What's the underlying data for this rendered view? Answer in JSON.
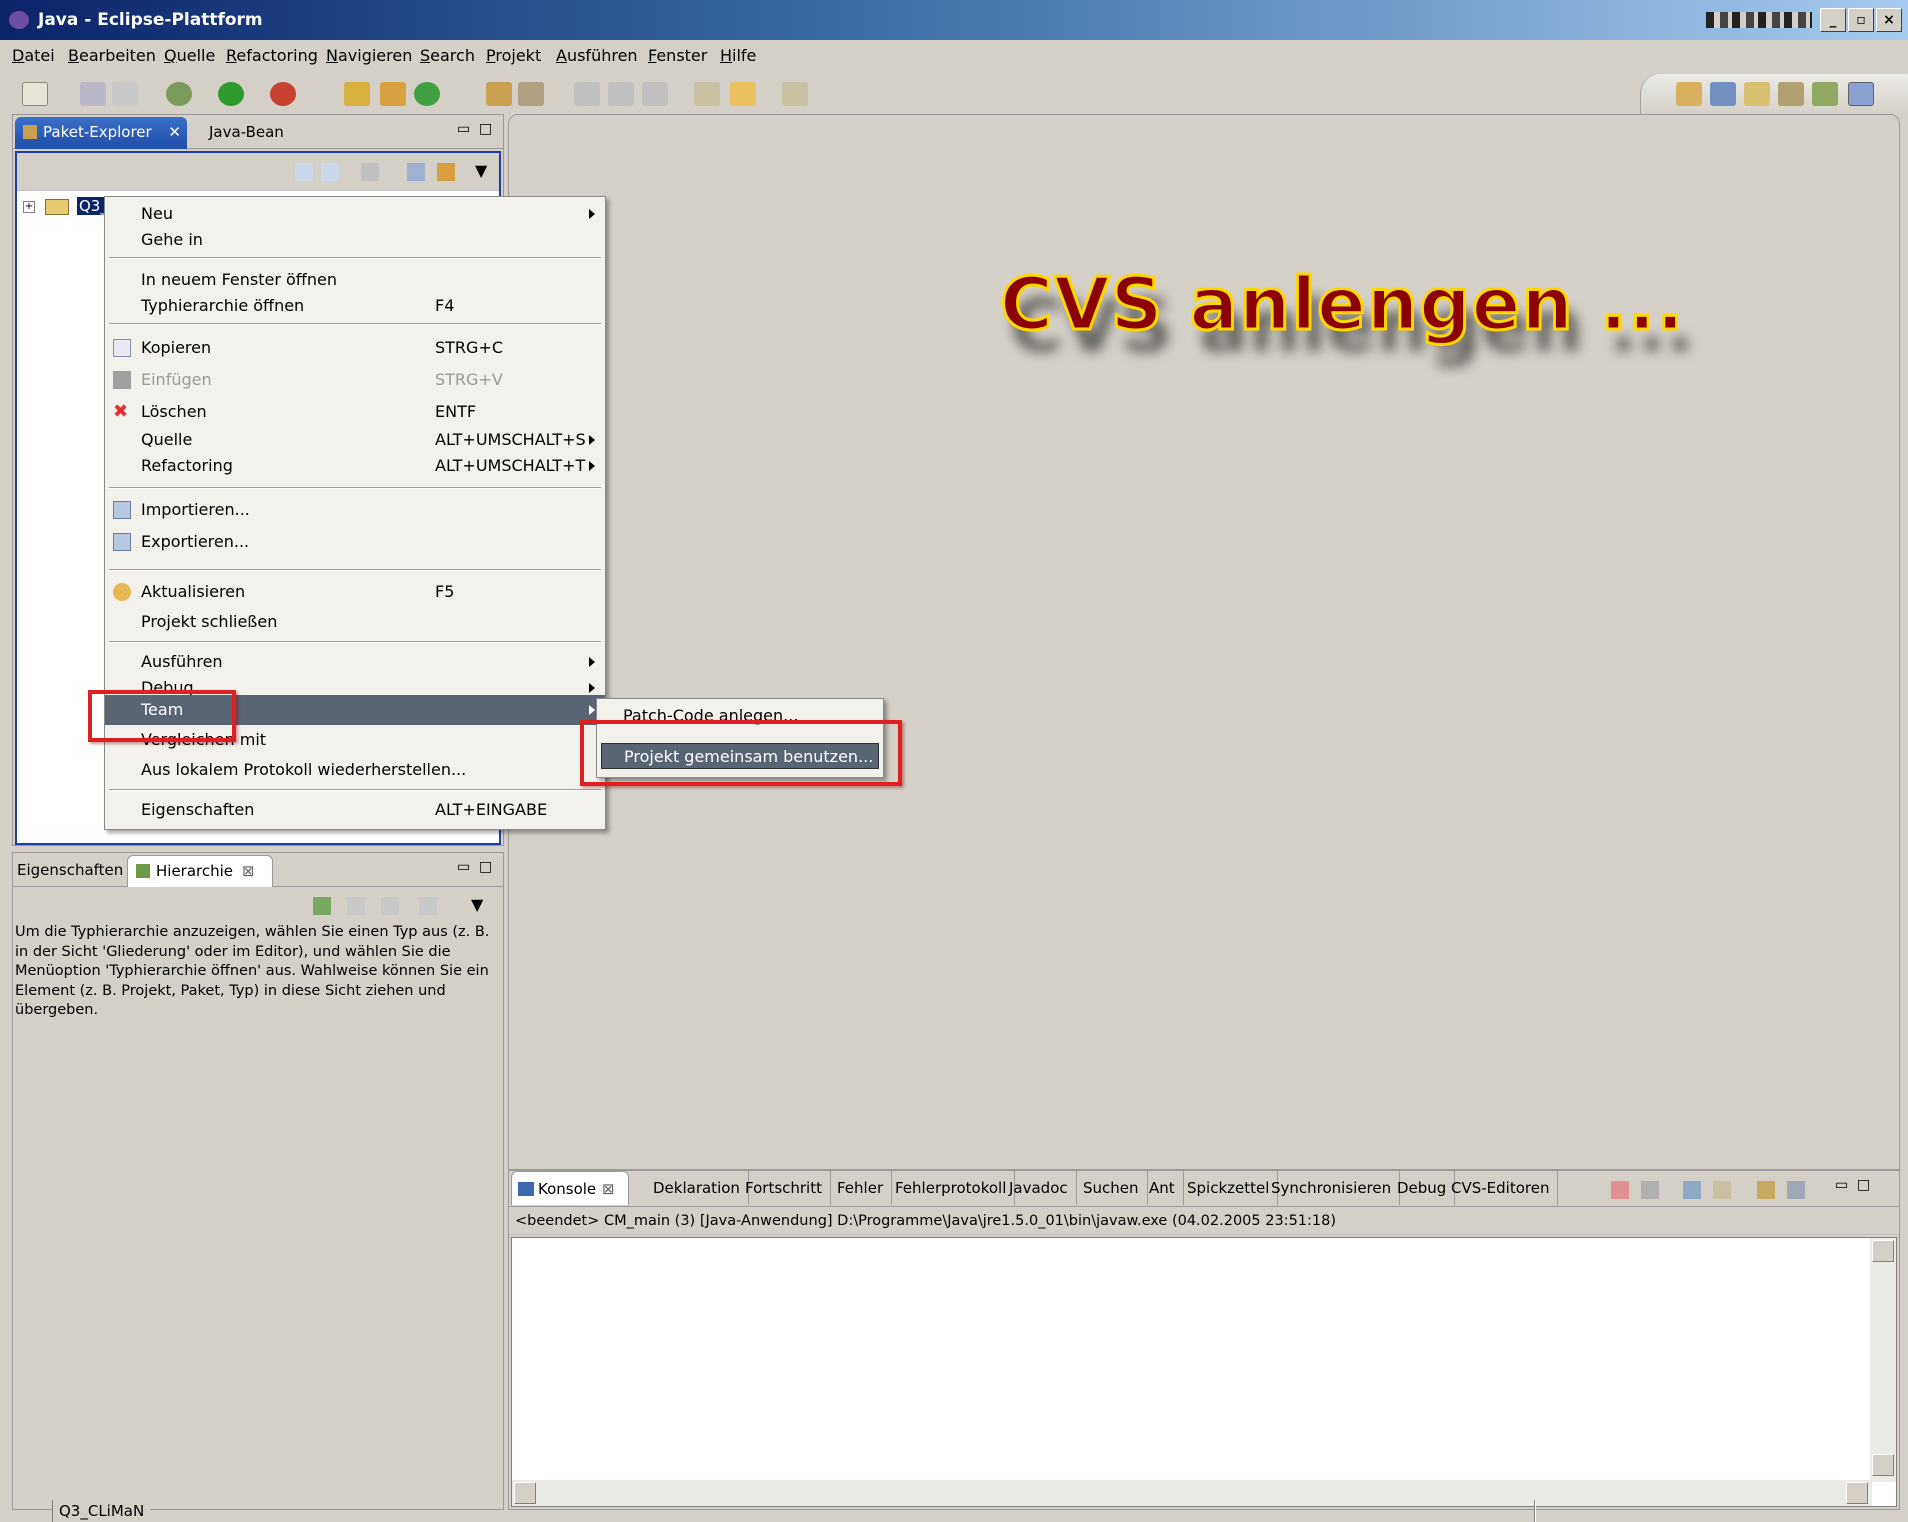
{
  "window": {
    "title": "Java - Eclipse-Plattform"
  },
  "menubar": [
    "Datei",
    "Bearbeiten",
    "Quelle",
    "Refactoring",
    "Navigieren",
    "Search",
    "Projekt",
    "Ausführen",
    "Fenster",
    "Hilfe"
  ],
  "left_top": {
    "tabs": {
      "active": "Paket-Explorer",
      "other": "Java-Bean"
    },
    "tree_item": "Q3_CLiMaN"
  },
  "context_menu": {
    "items": [
      {
        "label": "Neu",
        "submenu": true
      },
      {
        "label": "Gehe in"
      },
      {
        "label": "In neuem Fenster öffnen"
      },
      {
        "label": "Typhierarchie öffnen",
        "shortcut": "F4"
      },
      {
        "label": "Kopieren",
        "shortcut": "STRG+C",
        "icon": "copy-icon"
      },
      {
        "label": "Einfügen",
        "shortcut": "STRG+V",
        "icon": "paste-icon",
        "disabled": true
      },
      {
        "label": "Löschen",
        "shortcut": "ENTF",
        "icon": "delete-icon"
      },
      {
        "label": "Quelle",
        "shortcut": "ALT+UMSCHALT+S",
        "submenu": true
      },
      {
        "label": "Refactoring",
        "shortcut": "ALT+UMSCHALT+T",
        "submenu": true
      },
      {
        "label": "Importieren...",
        "icon": "import-icon"
      },
      {
        "label": "Exportieren...",
        "icon": "export-icon"
      },
      {
        "label": "Aktualisieren",
        "shortcut": "F5",
        "icon": "refresh-icon"
      },
      {
        "label": "Projekt schließen"
      },
      {
        "label": "Ausführen",
        "submenu": true
      },
      {
        "label": "Debug",
        "submenu": true
      },
      {
        "label": "Team",
        "submenu": true,
        "selected": true
      },
      {
        "label": "Vergleichen mit"
      },
      {
        "label": "Aus lokalem Protokoll wiederherstellen..."
      },
      {
        "label": "Eigenschaften",
        "shortcut": "ALT+EINGABE"
      }
    ]
  },
  "submenu": {
    "items": [
      {
        "label": "Patch-Code anlegen..."
      },
      {
        "label": "Projekt gemeinsam benutzen...",
        "selected": true
      }
    ]
  },
  "annotation": {
    "headline": "CVS anlengen ..."
  },
  "left_bottom": {
    "tabs": {
      "first": "Eigenschaften",
      "active": "Hierarchie"
    },
    "message": "Um die Typhierarchie anzuzeigen, wählen Sie einen Typ aus (z. B. in der Sicht 'Gliederung' oder im Editor), und wählen Sie die Menüoption 'Typhierarchie öffnen' aus. Wahlweise können Sie ein Element (z. B. Projekt, Paket, Typ) in diese Sicht ziehen und übergeben."
  },
  "console": {
    "tabs": [
      "Konsole",
      "Deklaration",
      "Fortschritt",
      "Fehler",
      "Fehlerprotokoll",
      "Javadoc",
      "Suchen",
      "Ant",
      "Spickzettel",
      "Synchronisieren",
      "Debug",
      "CVS-Editoren"
    ],
    "status_line": "<beendet> CM_main (3) [Java-Anwendung] D:\\Programme\\Java\\jre1.5.0_01\\bin\\javaw.exe (04.02.2005 23:51:18)"
  },
  "statusbar": {
    "text": "Q3_CLiMaN"
  },
  "colors": {
    "highlight_box": "#e02020",
    "headline_fill": "#8b0000",
    "headline_outline": "#ffd700",
    "active_tab": "#1f4fa8"
  }
}
